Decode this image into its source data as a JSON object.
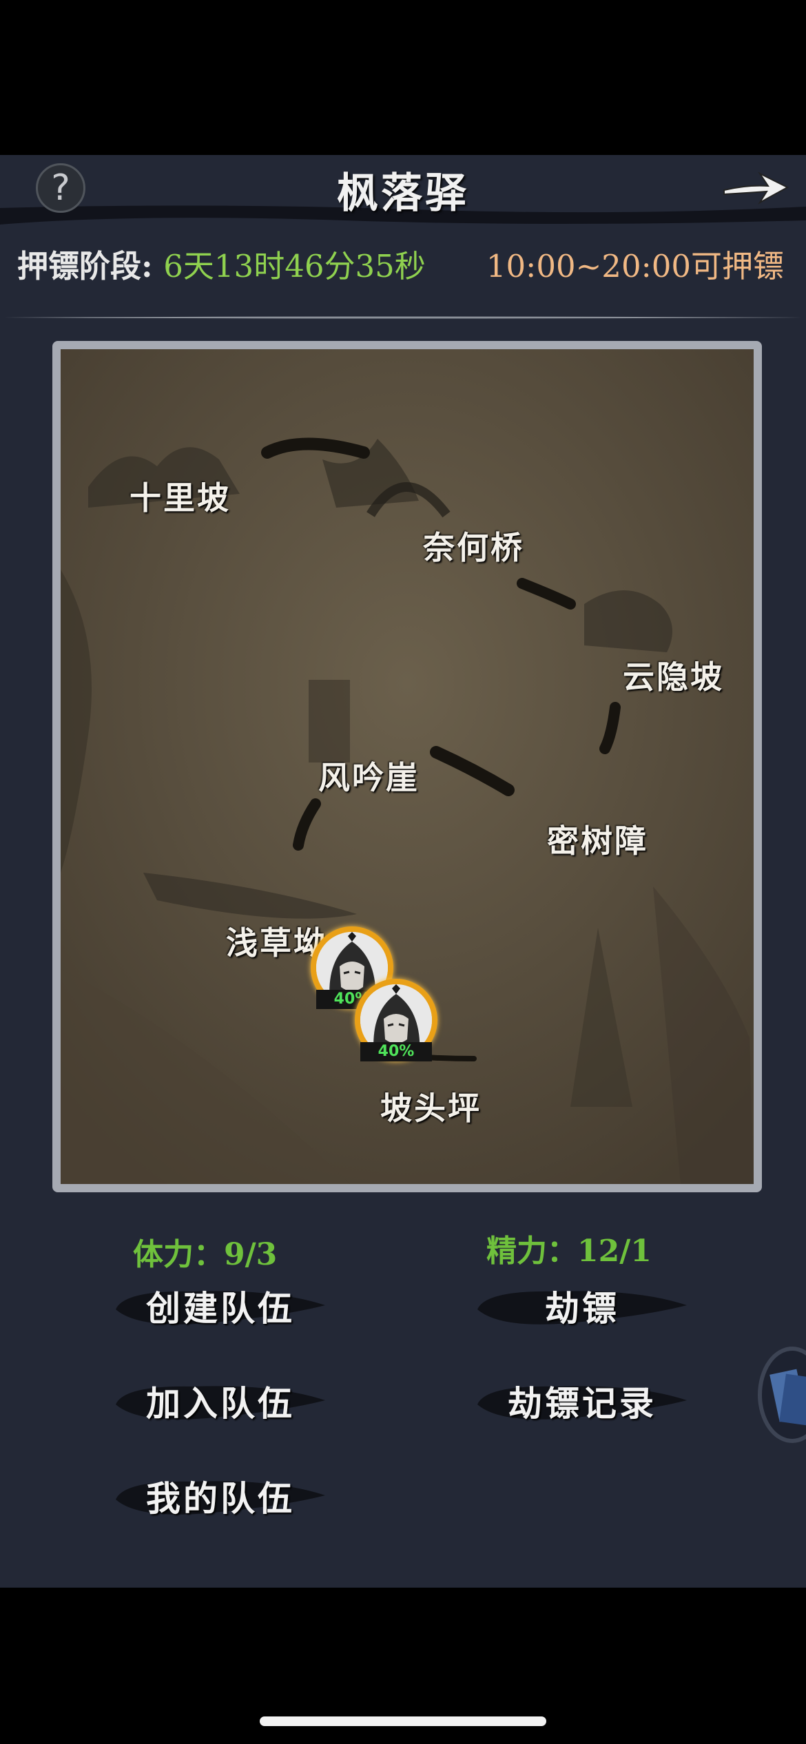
{
  "header": {
    "title": "枫落驿",
    "help_symbol": "?",
    "help_icon": "question-mark-icon",
    "next_icon": "arrow-right-icon"
  },
  "status": {
    "stage_label": "押镖阶段:",
    "stage_timer": "6天13时46分35秒",
    "time_window": "10:00~20:00可押镖"
  },
  "map": {
    "locations": [
      {
        "id": "shilipo",
        "label": "十里坡"
      },
      {
        "id": "naiheqiao",
        "label": "奈何桥"
      },
      {
        "id": "yunyinpo",
        "label": "云隐坡"
      },
      {
        "id": "fengyinya",
        "label": "风吟崖"
      },
      {
        "id": "mishuzhang",
        "label": "密树障"
      },
      {
        "id": "qiancaoao",
        "label": "浅草坳"
      },
      {
        "id": "potouping",
        "label": "坡头坪"
      }
    ],
    "escorts": [
      {
        "progress_label": "40%",
        "progress": 0.4
      },
      {
        "progress_label": "40%",
        "progress": 0.4
      }
    ]
  },
  "stats": {
    "stamina_label": "体力：9/3",
    "energy_label": "精力：12/1"
  },
  "actions": {
    "create_team": "创建队伍",
    "join_team": "加入队伍",
    "my_team": "我的队伍",
    "rob_escort": "劫镖",
    "rob_records": "劫镖记录"
  },
  "colors": {
    "panel_bg": "#232836",
    "timer_green": "#8fd14f",
    "window_orange": "#f0b884",
    "stat_green": "#6fc13c",
    "avatar_ring": "#e9a017"
  }
}
